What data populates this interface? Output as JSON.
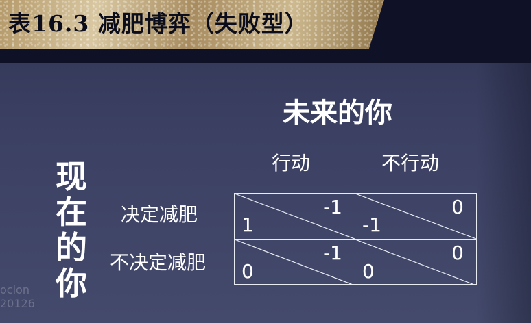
{
  "title": "表16.3 减肥博弈（失败型）",
  "future_you": "未来的你",
  "current_you_chars": [
    "现",
    "在",
    "的",
    "你"
  ],
  "columns": [
    "行动",
    "不行动"
  ],
  "rows": [
    "决定减肥",
    "不决定减肥"
  ],
  "payoffs": [
    [
      {
        "current": "1",
        "future": "-1"
      },
      {
        "current": "-1",
        "future": "0"
      }
    ],
    [
      {
        "current": "0",
        "future": "-1"
      },
      {
        "current": "0",
        "future": "0"
      }
    ]
  ],
  "watermark": [
    "oclon",
    "20126"
  ]
}
